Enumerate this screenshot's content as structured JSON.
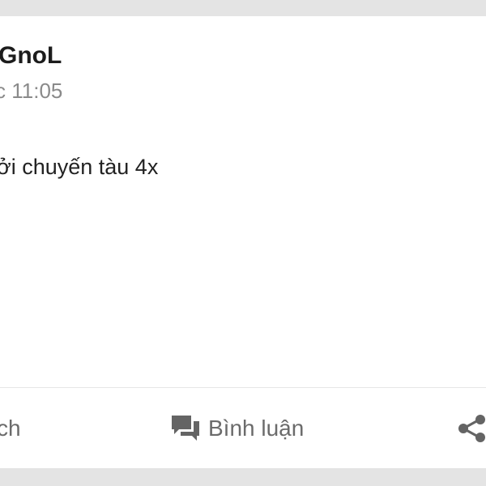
{
  "post": {
    "author": "GnoL",
    "time": "c 11:05",
    "content": "ởi chuyến tàu 4x"
  },
  "actions": {
    "like_label": "ch",
    "comment_label": "Bình luận",
    "comment_icon": "comment-icon",
    "share_icon": "share-icon"
  },
  "colors": {
    "background": "#e4e4e4",
    "card": "#ffffff",
    "author_text": "#1c1c1c",
    "meta_text": "#8a8a8a",
    "action_text": "#6b6b6b"
  }
}
